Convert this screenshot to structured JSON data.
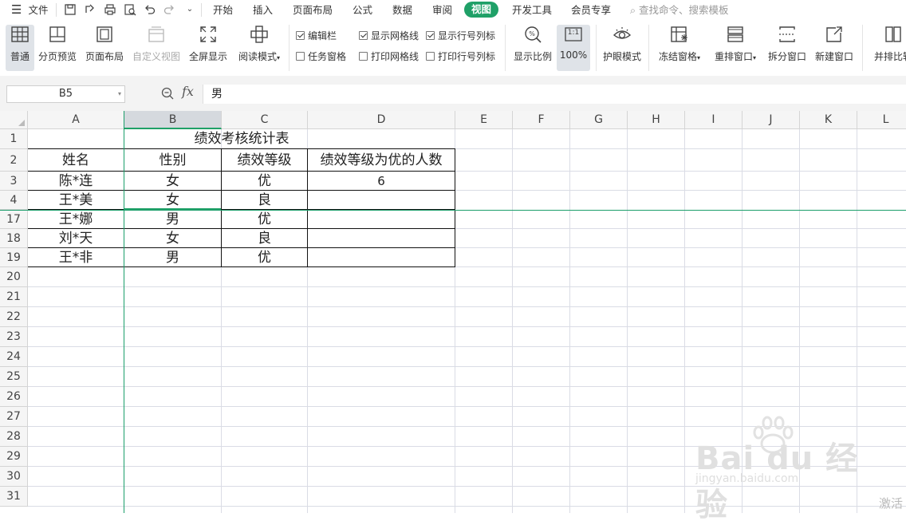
{
  "menu": {
    "file": "文件",
    "tabs": [
      "开始",
      "插入",
      "页面布局",
      "公式",
      "数据",
      "审阅",
      "视图",
      "开发工具",
      "会员专享"
    ],
    "active_tab": "视图",
    "search_placeholder": "查找命令、搜索模板"
  },
  "ribbon": {
    "view_buttons": [
      "普通",
      "分页预览",
      "页面布局",
      "自定义视图",
      "全屏显示",
      "阅读模式"
    ],
    "checkboxes": [
      {
        "label": "编辑栏",
        "checked": true
      },
      {
        "label": "显示网格线",
        "checked": true
      },
      {
        "label": "显示行号列标",
        "checked": true
      },
      {
        "label": "任务窗格",
        "checked": false
      },
      {
        "label": "打印网格线",
        "checked": false
      },
      {
        "label": "打印行号列标",
        "checked": false
      }
    ],
    "zoom_buttons": [
      "显示比例",
      "100%"
    ],
    "zoom_icon_text": "1:1",
    "window_buttons": [
      "护眼模式",
      "冻结窗格",
      "重排窗口",
      "拆分窗口",
      "新建窗口",
      "并排比较"
    ]
  },
  "formula_bar": {
    "name_box": "B5",
    "fx": "fx",
    "value": "男"
  },
  "sheet": {
    "columns": [
      "A",
      "B",
      "C",
      "D",
      "E",
      "F",
      "G",
      "H",
      "I",
      "J",
      "K",
      "L"
    ],
    "active_column": "B",
    "rows": [
      "1",
      "2",
      "3",
      "4",
      "17",
      "18",
      "19",
      "20",
      "21",
      "22",
      "23",
      "24",
      "25",
      "26",
      "27",
      "28",
      "29",
      "30",
      "31"
    ],
    "title": "绩效考核统计表",
    "headers": [
      "姓名",
      "性别",
      "绩效等级",
      "绩效等级为优的人数"
    ],
    "data": [
      [
        "陈*连",
        "女",
        "优",
        "6"
      ],
      [
        "王*美",
        "女",
        "良",
        ""
      ],
      [
        "王*娜",
        "男",
        "优",
        ""
      ],
      [
        "刘*天",
        "女",
        "良",
        ""
      ],
      [
        "王*非",
        "男",
        "优",
        ""
      ]
    ]
  },
  "watermark": {
    "brand": "Bai du 经验",
    "url": "jingyan.baidu.com"
  },
  "activate_text": "激活"
}
